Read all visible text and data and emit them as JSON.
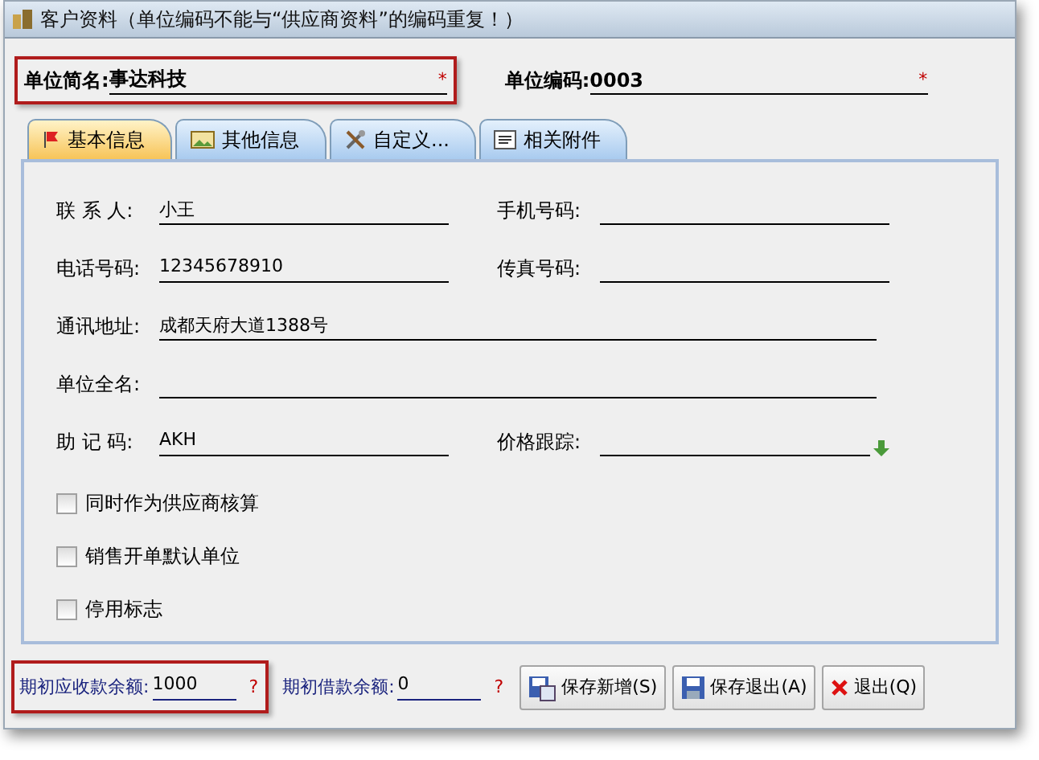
{
  "window": {
    "title": "客户资料（单位编码不能与“供应商资料”的编码重复！）"
  },
  "header_fields": [
    {
      "label": "单位简名:",
      "value": "事达科技",
      "required": "*",
      "highlighted": true
    },
    {
      "label": "单位编码:",
      "value": "0003",
      "required": "*",
      "highlighted": false
    }
  ],
  "tabs": [
    {
      "label": "基本信息",
      "selected": true
    },
    {
      "label": "其他信息",
      "selected": false
    },
    {
      "label": "自定义...",
      "selected": false
    },
    {
      "label": "相关附件",
      "selected": false
    }
  ],
  "field_rows": [
    [
      {
        "label": "联 系 人:",
        "value": "小王",
        "kind": "plain"
      },
      {
        "label": "手机号码:",
        "kind": "plain"
      }
    ],
    [
      {
        "label": "电话号码:",
        "value": "12345678910",
        "kind": "plain"
      },
      {
        "label": "传真号码:",
        "kind": "plain"
      }
    ],
    [
      {
        "label": "通讯地址:",
        "value": "成都天府大道1388号",
        "kind": "plain"
      }
    ],
    [
      {
        "label": "单位全名:",
        "kind": "plain"
      }
    ],
    [
      {
        "label": "助 记 码:",
        "value": "AKH",
        "kind": "plain"
      },
      {
        "label": "价格跟踪:",
        "kind": "lookup"
      }
    ]
  ],
  "checkboxes": [
    {
      "label": "同时作为供应商核算",
      "checked": false
    },
    {
      "label": "销售开单默认单位",
      "checked": false
    },
    {
      "label": "停用标志",
      "checked": false
    }
  ],
  "balances": [
    {
      "label": "期初应收款余额:",
      "value": "1000",
      "hint": "?",
      "highlighted": true
    },
    {
      "label": "期初借款余额:",
      "value": "0",
      "hint": "?",
      "highlighted": false
    }
  ],
  "buttons": [
    {
      "label": "保存新增(S)",
      "kind": "save-new"
    },
    {
      "label": "保存退出(A)",
      "kind": "save-exit"
    },
    {
      "label": "退出(Q)",
      "kind": "exit"
    }
  ]
}
